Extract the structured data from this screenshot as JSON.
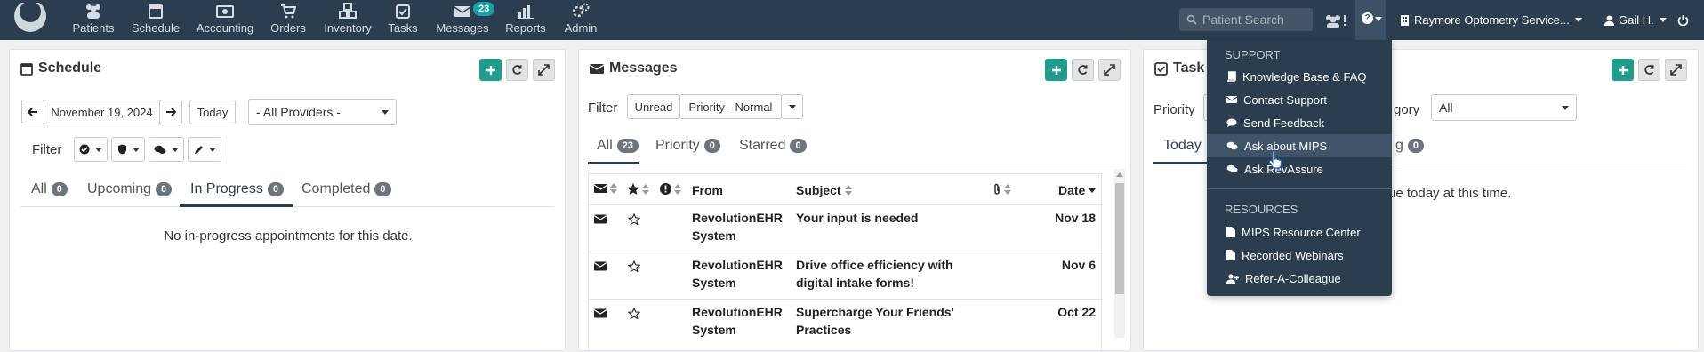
{
  "nav": {
    "items": [
      {
        "label": "Patients",
        "icon": "users-icon"
      },
      {
        "label": "Schedule",
        "icon": "calendar-icon"
      },
      {
        "label": "Accounting",
        "icon": "money-icon"
      },
      {
        "label": "Orders",
        "icon": "cart-icon"
      },
      {
        "label": "Inventory",
        "icon": "cubes-icon"
      },
      {
        "label": "Tasks",
        "icon": "check-square-icon"
      },
      {
        "label": "Messages",
        "icon": "envelope-icon"
      },
      {
        "label": "Reports",
        "icon": "bar-chart-icon"
      },
      {
        "label": "Admin",
        "icon": "cogs-icon"
      }
    ],
    "messages_badge": "23",
    "search_placeholder": "Patient Search",
    "location": "Raymore Optometry Service...",
    "user": "Gail H."
  },
  "schedule": {
    "title": "Schedule",
    "date": "November 19, 2024",
    "today_label": "Today",
    "provider": "- All Providers -",
    "filter_label": "Filter",
    "tabs": [
      {
        "label": "All",
        "count": "0"
      },
      {
        "label": "Upcoming",
        "count": "0"
      },
      {
        "label": "In Progress",
        "count": "0"
      },
      {
        "label": "Completed",
        "count": "0"
      }
    ],
    "empty_text": "No in-progress appointments for this date."
  },
  "messages": {
    "title": "Messages",
    "filter_label": "Filter",
    "filter_unread": "Unread",
    "filter_priority": "Priority - Normal",
    "tabs": [
      {
        "label": "All",
        "count": "23"
      },
      {
        "label": "Priority",
        "count": "0"
      },
      {
        "label": "Starred",
        "count": "0"
      }
    ],
    "columns": {
      "from": "From",
      "subject": "Subject",
      "date": "Date"
    },
    "rows": [
      {
        "from": "RevolutionEHR System",
        "subject": "Your input is needed",
        "date": "Nov 18"
      },
      {
        "from": "RevolutionEHR System",
        "subject": "Drive office efficiency with digital intake forms!",
        "date": "Nov 6"
      },
      {
        "from": "RevolutionEHR System",
        "subject": "Supercharge Your Friends' Practices",
        "date": "Oct 22"
      }
    ]
  },
  "tasks": {
    "title_partial": "Task",
    "priority_label": "Priority",
    "category_partial": "gory",
    "category_value": "All",
    "tab_today": "Today",
    "tab_partial": "g",
    "tab_count": "0",
    "empty_partial": "ue today at this time."
  },
  "help_menu": {
    "support_header": "SUPPORT",
    "support_items": [
      {
        "label": "Knowledge Base & FAQ",
        "icon": "book-icon"
      },
      {
        "label": "Contact Support",
        "icon": "envelope-icon"
      },
      {
        "label": "Send Feedback",
        "icon": "comment-icon"
      },
      {
        "label": "Ask about MIPS",
        "icon": "comments-icon"
      },
      {
        "label": "Ask RevAssure",
        "icon": "comments-icon"
      }
    ],
    "resources_header": "RESOURCES",
    "resource_items": [
      {
        "label": "MIPS Resource Center",
        "icon": "file-icon"
      },
      {
        "label": "Recorded Webinars",
        "icon": "file-icon"
      },
      {
        "label": "Refer-A-Colleague",
        "icon": "user-plus-icon"
      }
    ]
  },
  "colors": {
    "navbar": "#2b3e50",
    "accent_green": "#1f9e8c",
    "badge_teal": "#17a2a5"
  }
}
